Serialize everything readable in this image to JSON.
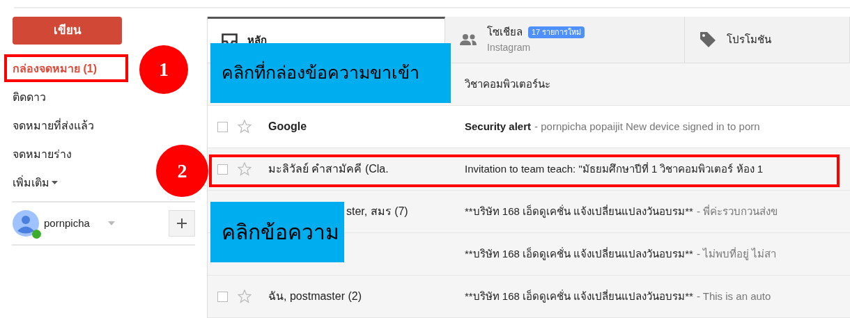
{
  "compose_button": "เขียน",
  "sidebar": {
    "items": [
      {
        "label": "กล่องจดหมาย (1)",
        "selected": true
      },
      {
        "label": "ติดดาว",
        "selected": false
      },
      {
        "label": "จดหมายที่ส่งแล้ว",
        "selected": false
      },
      {
        "label": "จดหมายร่าง",
        "selected": false
      },
      {
        "label": "เพิ่มเติม",
        "selected": false,
        "kind": "menu"
      }
    ]
  },
  "account": {
    "name": "pornpicha",
    "online": true
  },
  "tabs": [
    {
      "kind": "inbox",
      "label": "หลัก",
      "selected": true
    },
    {
      "kind": "people",
      "label": "โซเชียล",
      "badge": "17 รายการใหม่",
      "subtitle": "Instagram",
      "selected": false
    },
    {
      "kind": "tag",
      "label": "โปรโมชัน",
      "selected": false
    }
  ],
  "rows": [
    {
      "subject": "วิชาคอมพิวเตอร์นะ",
      "unread": false
    },
    {
      "sender": "Google",
      "subject": "Security alert",
      "snippet": "- pornpicha popaijit New device signed in to porn",
      "unread": true
    },
    {
      "sender": "มะลิวัลย์ คำสามัคคี (Cla.",
      "subject": "Invitation to team teach: \"มัธยมศึกษาปีที่ 1 วิชาคอมพิวเตอร์ ห้อง 1",
      "unread": false
    },
    {
      "sender": "ster, สมร (7)",
      "sender_partial": true,
      "subject": "**บริษัท 168 เอ็ดดูเคชั่น แจ้งเปลี่ยนแปลงวันอบรม**",
      "snippet": "- พี่ค่ะรวบกวนส่งข",
      "unread": false
    },
    {
      "subject": "**บริษัท 168 เอ็ดดูเคชั่น แจ้งเปลี่ยนแปลงวันอบรม**",
      "snippet": "- ไม่พบที่อยู่ ไม่สา",
      "unread": false
    },
    {
      "sender": "ฉัน, postmaster (2)",
      "subject": "**บริษัท 168 เอ็ดดูเคชั่น แจ้งเปลี่ยนแปลงวันอบรม**",
      "snippet": "- This is an auto",
      "unread": false
    }
  ],
  "annotations": [
    {
      "number": "1",
      "callout": "คลิกที่กล่องข้อความขาเข้า"
    },
    {
      "number": "2",
      "callout": "คลิกข้อความ"
    }
  ]
}
